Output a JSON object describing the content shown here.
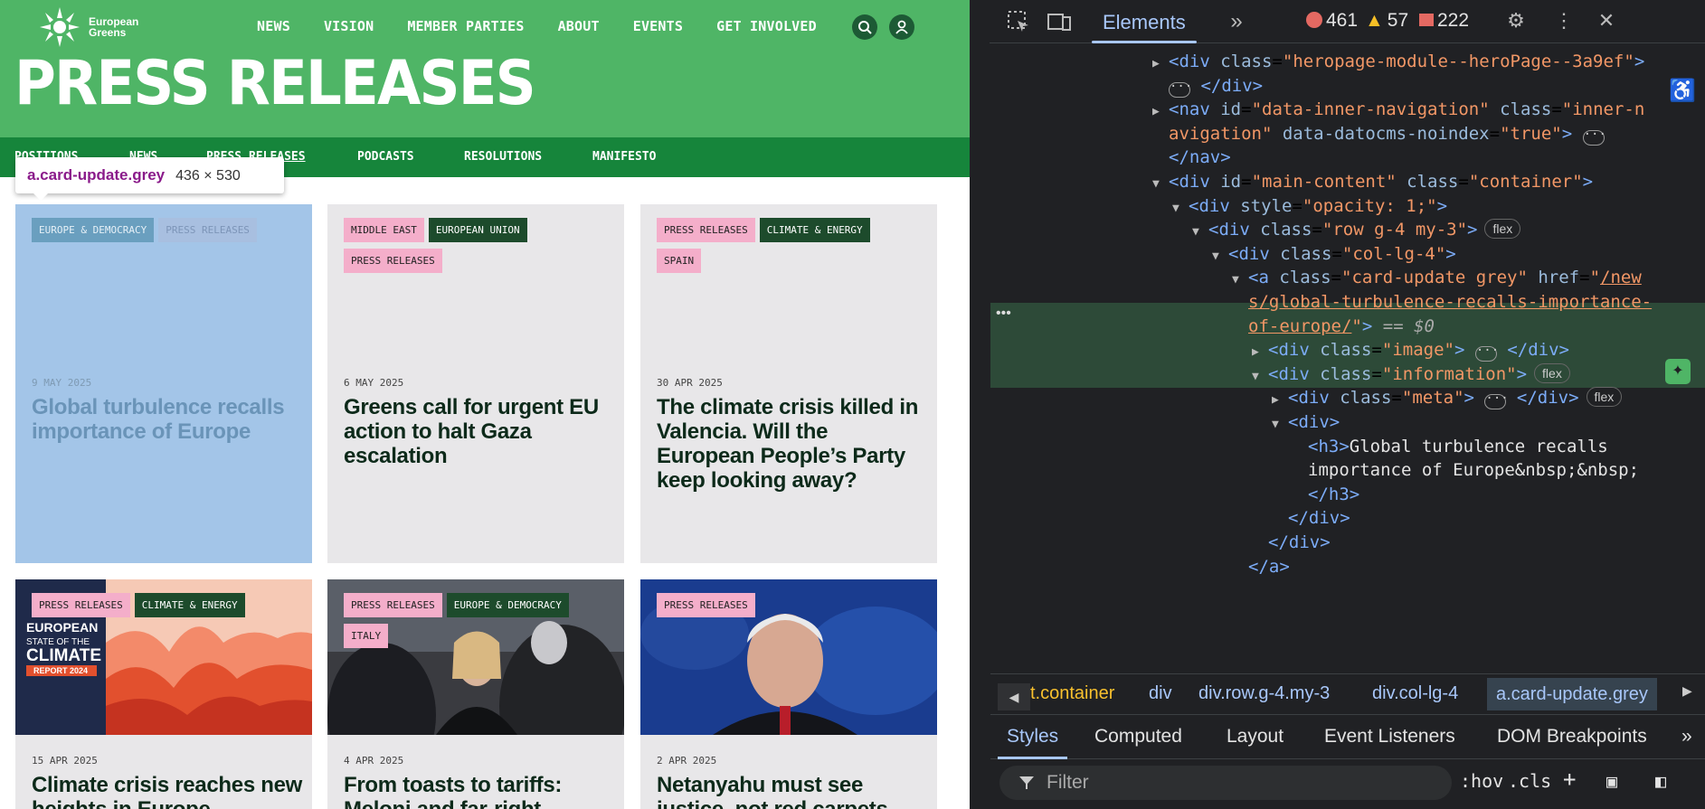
{
  "site": {
    "logo_text_1": "European",
    "logo_text_2": "Greens",
    "nav": [
      "NEWS",
      "VISION",
      "MEMBER PARTIES",
      "ABOUT",
      "EVENTS",
      "GET INVOLVED"
    ],
    "title": "PRESS RELEASES",
    "subnav": [
      "POSITIONS",
      "NEWS",
      "PRESS RELEASES",
      "PODCASTS",
      "RESOLUTIONS",
      "MANIFESTO"
    ],
    "tooltip": {
      "selector": "a.card-update.grey",
      "size": "436 × 530"
    },
    "cards": [
      {
        "tags": [
          [
            "EUROPE & DEMOCRACY",
            "b"
          ],
          [
            "PRESS RELEASES",
            "bl"
          ]
        ],
        "date": "9 MAY 2025",
        "title": "Global turbulence recalls importance of Europe"
      },
      {
        "tags": [
          [
            "MIDDLE EAST",
            "p"
          ],
          [
            "EUROPEAN UNION",
            "d"
          ],
          [
            "PRESS RELEASES",
            "p"
          ]
        ],
        "date": "6 MAY 2025",
        "title": "Greens call for urgent EU action to halt Gaza escalation"
      },
      {
        "tags": [
          [
            "PRESS RELEASES",
            "p"
          ],
          [
            "CLIMATE & ENERGY",
            "d"
          ],
          [
            "SPAIN",
            "p"
          ]
        ],
        "date": "30 APR 2025",
        "title": "The climate crisis killed in Valencia. Will the European People’s Party keep looking away?"
      },
      {
        "tags": [
          [
            "PRESS RELEASES",
            "p"
          ],
          [
            "CLIMATE & ENERGY",
            "d"
          ]
        ],
        "date": "15 APR 2025",
        "title": "Climate crisis reaches new heights in Europe"
      },
      {
        "tags": [
          [
            "PRESS RELEASES",
            "p"
          ],
          [
            "EUROPE & DEMOCRACY",
            "d"
          ],
          [
            "ITALY",
            "p"
          ]
        ],
        "date": "4 APR 2025",
        "title": "From toasts to tariffs: Meloni and far-right"
      },
      {
        "tags": [
          [
            "PRESS RELEASES",
            "p"
          ]
        ],
        "date": "2 APR 2025",
        "title": "Netanyahu must see justice, not red carpets"
      }
    ],
    "climate_img_text": [
      "EUROPEAN",
      "STATE OF THE",
      "CLIMATE",
      "REPORT 2024"
    ]
  },
  "devtools": {
    "tab": "Elements",
    "errors": "461",
    "warnings": "57",
    "issues": "222",
    "tree": [
      {
        "d": 9,
        "tri": "r",
        "html": "<span class='tagc'>&lt;div</span> <span class='attr'>class</span>=<span class='val'>\"heropage-module--heroPage--3a9ef\"</span><span class='tagc'>&gt;</span>"
      },
      {
        "d": 9,
        "tri": "",
        "html": "<span class='ell'>···</span> <span class='tagc'>&lt;/div&gt;</span>"
      },
      {
        "d": 9,
        "tri": "r",
        "html": "<span class='tagc'>&lt;nav</span> <span class='attr'>id</span>=<span class='val'>\"data-inner-navigation\"</span> <span class='attr'>class</span>=<span class='val'>\"inner-n</span>"
      },
      {
        "d": 9,
        "tri": "",
        "html": "<span class='val'>avigation\"</span> <span class='attr'>data-datocms-noindex</span>=<span class='val'>\"true\"</span><span class='tagc'>&gt;</span> <span class='ell'>···</span>"
      },
      {
        "d": 9,
        "tri": "",
        "html": "<span class='tagc'>&lt;/nav&gt;</span>"
      },
      {
        "d": 9,
        "tri": "d",
        "html": "<span class='tagc'>&lt;div</span> <span class='attr'>id</span>=<span class='val'>\"main-content\"</span> <span class='attr'>class</span>=<span class='val'>\"container\"</span><span class='tagc'>&gt;</span>"
      },
      {
        "d": 10,
        "tri": "d",
        "html": "<span class='tagc'>&lt;div</span> <span class='attr'>style</span>=<span class='val'>\"opacity: 1;\"</span><span class='tagc'>&gt;</span>"
      },
      {
        "d": 11,
        "tri": "d",
        "html": "<span class='tagc'>&lt;div</span> <span class='attr'>class</span>=<span class='val'>\"row g-4 my-3\"</span><span class='tagc'>&gt;</span><span class='badge'>flex</span>"
      },
      {
        "d": 12,
        "tri": "d",
        "html": "<span class='tagc'>&lt;div</span> <span class='attr'>class</span>=<span class='val'>\"col-lg-4\"</span><span class='tagc'>&gt;</span>"
      },
      {
        "d": 13,
        "tri": "d",
        "html": "<span class='tagc'>&lt;a</span> <span class='attr'>class</span>=<span class='val'>\"card-update  grey\"</span> <span class='attr'>href</span>=<span class='val'>\"<u>/new</u></span>"
      },
      {
        "d": 13,
        "tri": "",
        "html": "<span class='val'><u>s/global-turbulence-recalls-importance-</u></span>"
      },
      {
        "d": 13,
        "tri": "",
        "html": "<span class='val'><u>of-europe/</u>\"</span><span class='tagc'>&gt;</span> <span style='color:#aaa'>== <i>$0</i></span>"
      },
      {
        "d": 14,
        "tri": "r",
        "html": "<span class='tagc'>&lt;div</span> <span class='attr'>class</span>=<span class='val'>\"image\"</span><span class='tagc'>&gt;</span> <span class='ell'>···</span> <span class='tagc'>&lt;/div&gt;</span>"
      },
      {
        "d": 14,
        "tri": "d",
        "html": "<span class='tagc'>&lt;div</span> <span class='attr'>class</span>=<span class='val'>\"information\"</span><span class='tagc'>&gt;</span><span class='badge'>flex</span>"
      },
      {
        "d": 15,
        "tri": "r",
        "html": "<span class='tagc'>&lt;div</span> <span class='attr'>class</span>=<span class='val'>\"meta\"</span><span class='tagc'>&gt;</span> <span class='ell'>···</span> <span class='tagc'>&lt;/div&gt;</span><span class='badge'>flex</span>"
      },
      {
        "d": 15,
        "tri": "d",
        "html": "<span class='tagc'>&lt;div&gt;</span>"
      },
      {
        "d": 16,
        "tri": "",
        "html": "<span class='tagc'>&lt;h3&gt;</span><span class='txt'>Global turbulence recalls</span>"
      },
      {
        "d": 16,
        "tri": "",
        "html": "<span class='txt'>importance of Europe&amp;nbsp;&amp;nbsp;</span>"
      },
      {
        "d": 16,
        "tri": "",
        "html": "<span class='tagc'>&lt;/h3&gt;</span>"
      },
      {
        "d": 15,
        "tri": "",
        "html": "<span class='tagc'>&lt;/div&gt;</span>"
      },
      {
        "d": 14,
        "tri": "",
        "html": "<span class='tagc'>&lt;/div&gt;</span>"
      },
      {
        "d": 13,
        "tri": "",
        "html": "<span class='tagc'>&lt;/a&gt;</span>"
      }
    ],
    "breadcrumbs": [
      "t.container",
      "div",
      "div.row.g-4.my-3",
      "div.col-lg-4",
      "a.card-update.grey"
    ],
    "bottom_tabs": [
      "Styles",
      "Computed",
      "Layout",
      "Event Listeners",
      "DOM Breakpoints"
    ],
    "filter_placeholder": "Filter",
    "hov": ":hov",
    "cls": ".cls"
  }
}
